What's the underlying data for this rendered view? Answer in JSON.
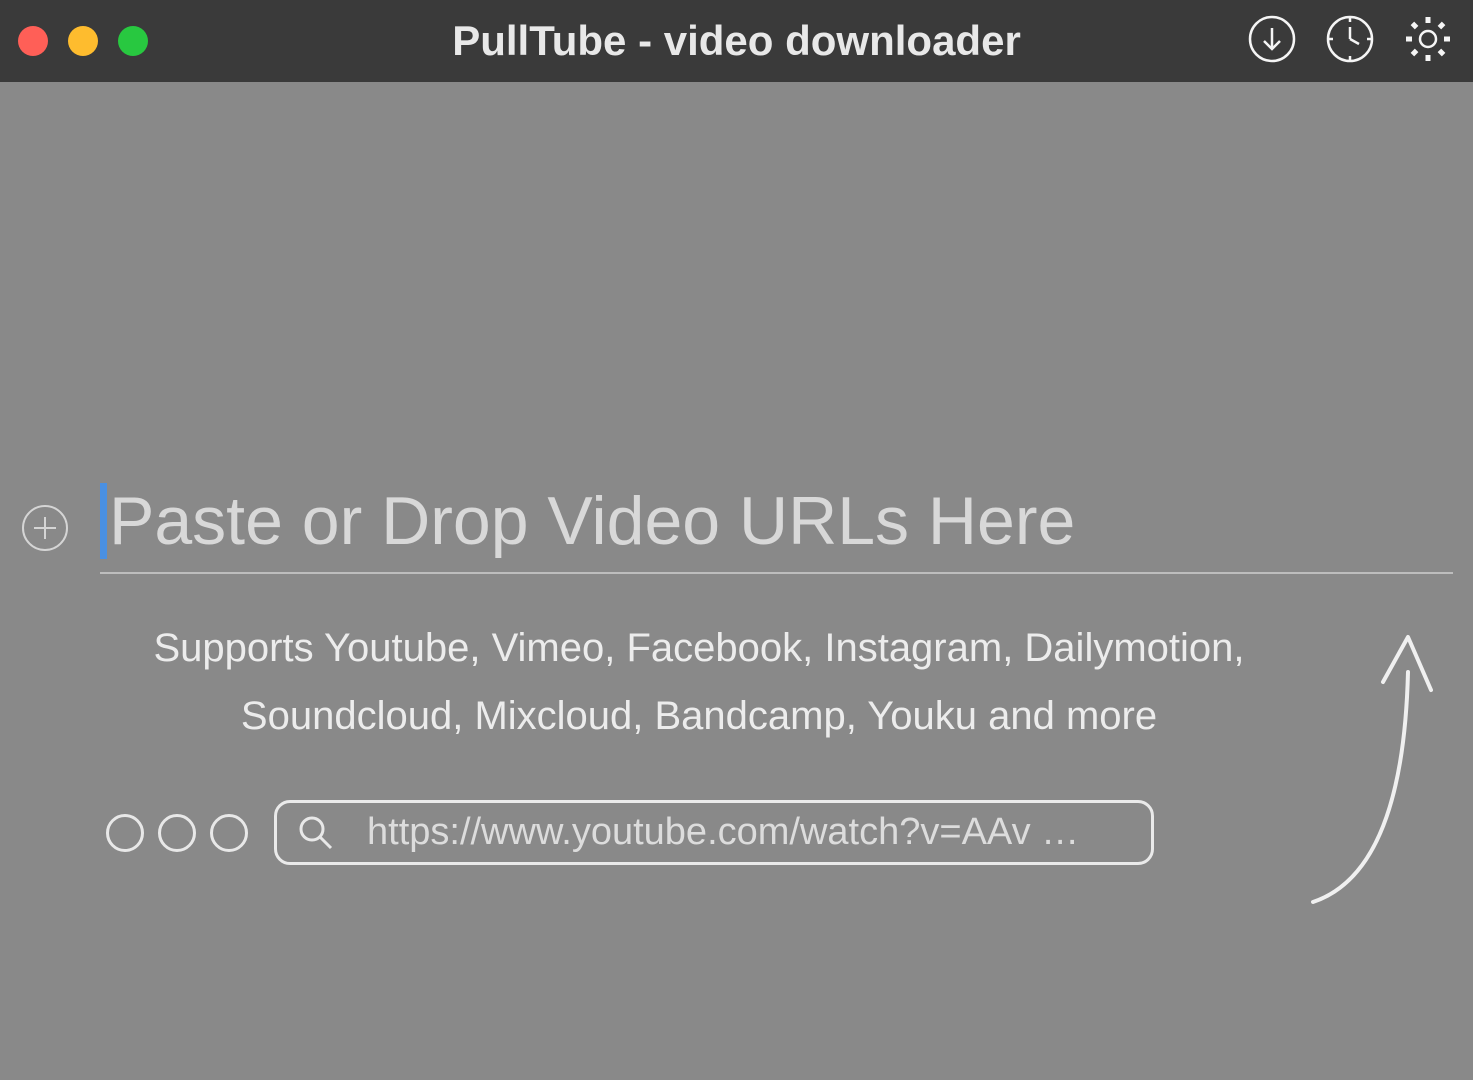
{
  "titlebar": {
    "title": "PullTube - video downloader"
  },
  "main": {
    "url_placeholder": "Paste or Drop Video URLs Here",
    "supports_text": "Supports Youtube, Vimeo, Facebook, Instagram, Dailymotion, Soundcloud, Mixcloud, Bandcamp, Youku and more",
    "example_url": "https://www.youtube.com/watch?v=AAv …"
  }
}
